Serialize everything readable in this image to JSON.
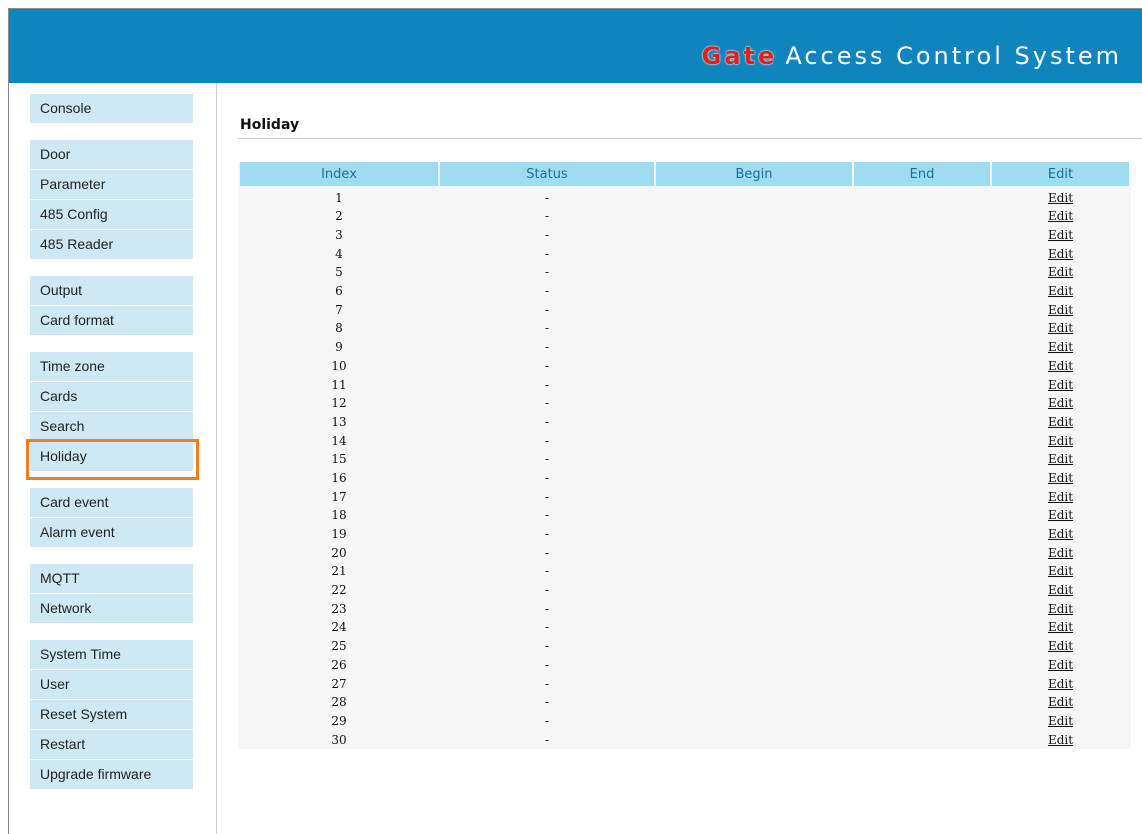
{
  "brand": {
    "highlight": "Gate",
    "rest": "Access Control System"
  },
  "colors": {
    "header": "#0f84bd",
    "nav_bg": "#cfe8f5",
    "active_outline": "#f07f24",
    "table_header": "#a0dcef",
    "brand_highlight": "#e0201a"
  },
  "sidebar": {
    "groups": [
      {
        "items": [
          "Console"
        ]
      },
      {
        "items": [
          "Door",
          "Parameter",
          "485 Config",
          "485 Reader"
        ]
      },
      {
        "items": [
          "Output",
          "Card format"
        ]
      },
      {
        "items": [
          "Time zone",
          "Cards",
          "Search",
          "Holiday"
        ]
      },
      {
        "items": [
          "Card event",
          "Alarm event"
        ]
      },
      {
        "items": [
          "MQTT",
          "Network"
        ]
      },
      {
        "items": [
          "System Time",
          "User",
          "Reset System",
          "Restart",
          "Upgrade firmware"
        ]
      }
    ],
    "active": "Holiday"
  },
  "page": {
    "title": "Holiday"
  },
  "table": {
    "columns": [
      "Index",
      "Status",
      "Begin",
      "End",
      "Edit"
    ],
    "rows": [
      {
        "index": "1",
        "status": "-",
        "begin": "",
        "end": "",
        "edit": "Edit"
      },
      {
        "index": "2",
        "status": "-",
        "begin": "",
        "end": "",
        "edit": "Edit"
      },
      {
        "index": "3",
        "status": "-",
        "begin": "",
        "end": "",
        "edit": "Edit"
      },
      {
        "index": "4",
        "status": "-",
        "begin": "",
        "end": "",
        "edit": "Edit"
      },
      {
        "index": "5",
        "status": "-",
        "begin": "",
        "end": "",
        "edit": "Edit"
      },
      {
        "index": "6",
        "status": "-",
        "begin": "",
        "end": "",
        "edit": "Edit"
      },
      {
        "index": "7",
        "status": "-",
        "begin": "",
        "end": "",
        "edit": "Edit"
      },
      {
        "index": "8",
        "status": "-",
        "begin": "",
        "end": "",
        "edit": "Edit"
      },
      {
        "index": "9",
        "status": "-",
        "begin": "",
        "end": "",
        "edit": "Edit"
      },
      {
        "index": "10",
        "status": "-",
        "begin": "",
        "end": "",
        "edit": "Edit"
      },
      {
        "index": "11",
        "status": "-",
        "begin": "",
        "end": "",
        "edit": "Edit"
      },
      {
        "index": "12",
        "status": "-",
        "begin": "",
        "end": "",
        "edit": "Edit"
      },
      {
        "index": "13",
        "status": "-",
        "begin": "",
        "end": "",
        "edit": "Edit"
      },
      {
        "index": "14",
        "status": "-",
        "begin": "",
        "end": "",
        "edit": "Edit"
      },
      {
        "index": "15",
        "status": "-",
        "begin": "",
        "end": "",
        "edit": "Edit"
      },
      {
        "index": "16",
        "status": "-",
        "begin": "",
        "end": "",
        "edit": "Edit"
      },
      {
        "index": "17",
        "status": "-",
        "begin": "",
        "end": "",
        "edit": "Edit"
      },
      {
        "index": "18",
        "status": "-",
        "begin": "",
        "end": "",
        "edit": "Edit"
      },
      {
        "index": "19",
        "status": "-",
        "begin": "",
        "end": "",
        "edit": "Edit"
      },
      {
        "index": "20",
        "status": "-",
        "begin": "",
        "end": "",
        "edit": "Edit"
      },
      {
        "index": "21",
        "status": "-",
        "begin": "",
        "end": "",
        "edit": "Edit"
      },
      {
        "index": "22",
        "status": "-",
        "begin": "",
        "end": "",
        "edit": "Edit"
      },
      {
        "index": "23",
        "status": "-",
        "begin": "",
        "end": "",
        "edit": "Edit"
      },
      {
        "index": "24",
        "status": "-",
        "begin": "",
        "end": "",
        "edit": "Edit"
      },
      {
        "index": "25",
        "status": "-",
        "begin": "",
        "end": "",
        "edit": "Edit"
      },
      {
        "index": "26",
        "status": "-",
        "begin": "",
        "end": "",
        "edit": "Edit"
      },
      {
        "index": "27",
        "status": "-",
        "begin": "",
        "end": "",
        "edit": "Edit"
      },
      {
        "index": "28",
        "status": "-",
        "begin": "",
        "end": "",
        "edit": "Edit"
      },
      {
        "index": "29",
        "status": "-",
        "begin": "",
        "end": "",
        "edit": "Edit"
      },
      {
        "index": "30",
        "status": "-",
        "begin": "",
        "end": "",
        "edit": "Edit"
      }
    ]
  }
}
